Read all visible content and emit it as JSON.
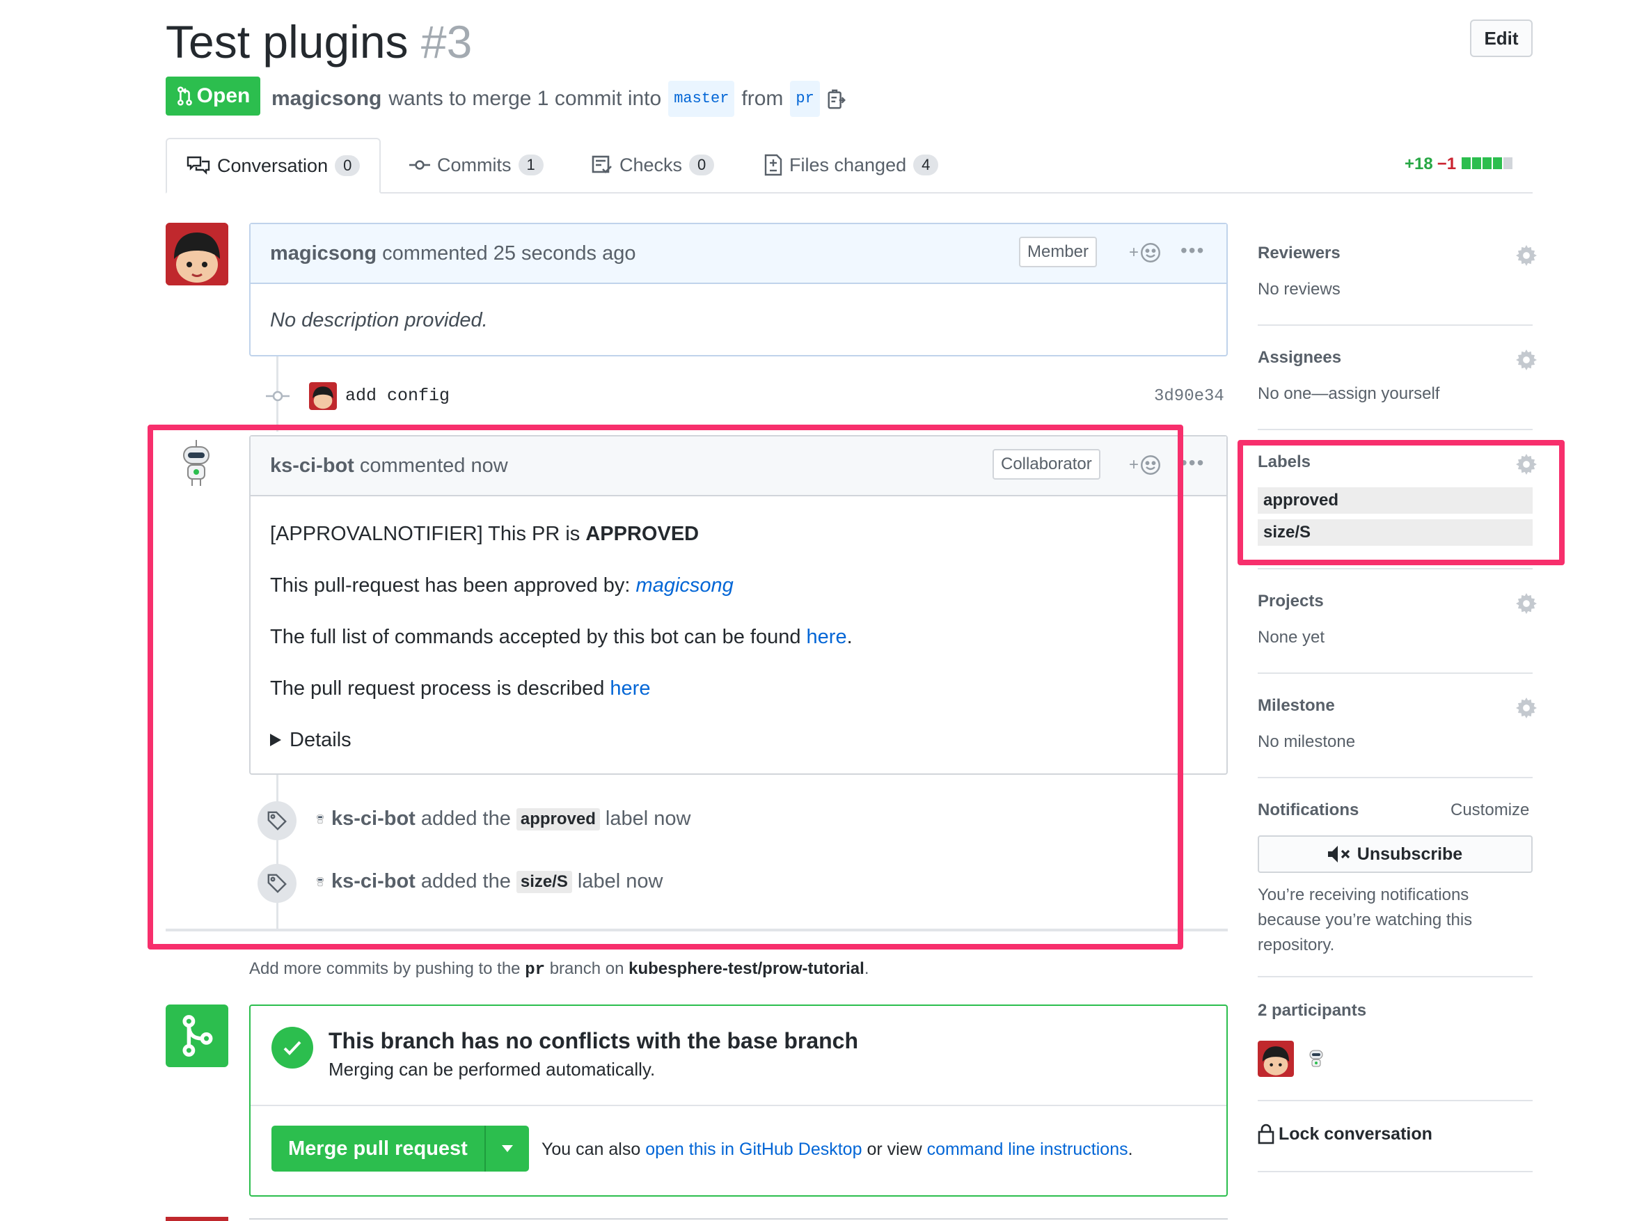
{
  "header": {
    "title": "Test plugins",
    "number": "#3",
    "edit_label": "Edit",
    "state": "Open",
    "author": "magicsong",
    "merge_text": "wants to merge 1 commit into",
    "base_branch": "master",
    "from_text": "from",
    "head_branch": "pr"
  },
  "tabs": [
    {
      "label": "Conversation",
      "count": "0"
    },
    {
      "label": "Commits",
      "count": "1"
    },
    {
      "label": "Checks",
      "count": "0"
    },
    {
      "label": "Files changed",
      "count": "4"
    }
  ],
  "diffstat": {
    "additions": "+18",
    "deletions": "−1",
    "blocks": [
      "green",
      "green",
      "green",
      "green",
      "gray"
    ]
  },
  "comment1": {
    "author": "magicsong",
    "meta": "commented 25 seconds ago",
    "role": "Member",
    "body": "No description provided."
  },
  "commit": {
    "message": "add config",
    "sha": "3d90e34"
  },
  "comment2": {
    "author": "ks-ci-bot",
    "meta": "commented now",
    "role": "Collaborator",
    "line1_prefix": "[APPROVALNOTIFIER] This PR is",
    "line1_bold": "APPROVED",
    "line2_prefix": "This pull-request has been approved by:",
    "line2_link": "magicsong",
    "line3_prefix": "The full list of commands accepted by this bot can be found",
    "line3_link": "here",
    "line3_suffix": ".",
    "line4_prefix": "The pull request process is described",
    "line4_link": "here",
    "details": "Details"
  },
  "events": [
    {
      "actor": "ks-ci-bot",
      "text_before": "added the",
      "label": "approved",
      "text_after": "label now"
    },
    {
      "actor": "ks-ci-bot",
      "text_before": "added the",
      "label": "size/S",
      "text_after": "label now"
    }
  ],
  "push_hint": {
    "prefix": "Add more commits by pushing to the",
    "branch": "pr",
    "middle": "branch on",
    "repo": "kubesphere-test/prow-tutorial",
    "suffix": "."
  },
  "merge": {
    "title": "This branch has no conflicts with the base branch",
    "subtitle": "Merging can be performed automatically.",
    "button": "Merge pull request",
    "also_prefix": "You can also",
    "desktop_link": "open this in GitHub Desktop",
    "or_text": "or view",
    "cli_link": "command line instructions",
    "suffix": "."
  },
  "sidebar": {
    "reviewers": {
      "title": "Reviewers",
      "value": "No reviews"
    },
    "assignees": {
      "title": "Assignees",
      "value": "No one—assign yourself"
    },
    "labels": {
      "title": "Labels",
      "items": [
        "approved",
        "size/S"
      ]
    },
    "projects": {
      "title": "Projects",
      "value": "None yet"
    },
    "milestone": {
      "title": "Milestone",
      "value": "No milestone"
    },
    "notifications": {
      "title": "Notifications",
      "customize": "Customize",
      "button": "Unsubscribe",
      "reason_lines": [
        "You’re receiving notifications",
        "because you’re watching this",
        "repository."
      ]
    },
    "participants": {
      "title": "2 participants"
    },
    "lock": "Lock conversation"
  },
  "colors": {
    "green": "#2cbe4e",
    "highlight": "#f72f6c",
    "link": "#0366d6"
  }
}
